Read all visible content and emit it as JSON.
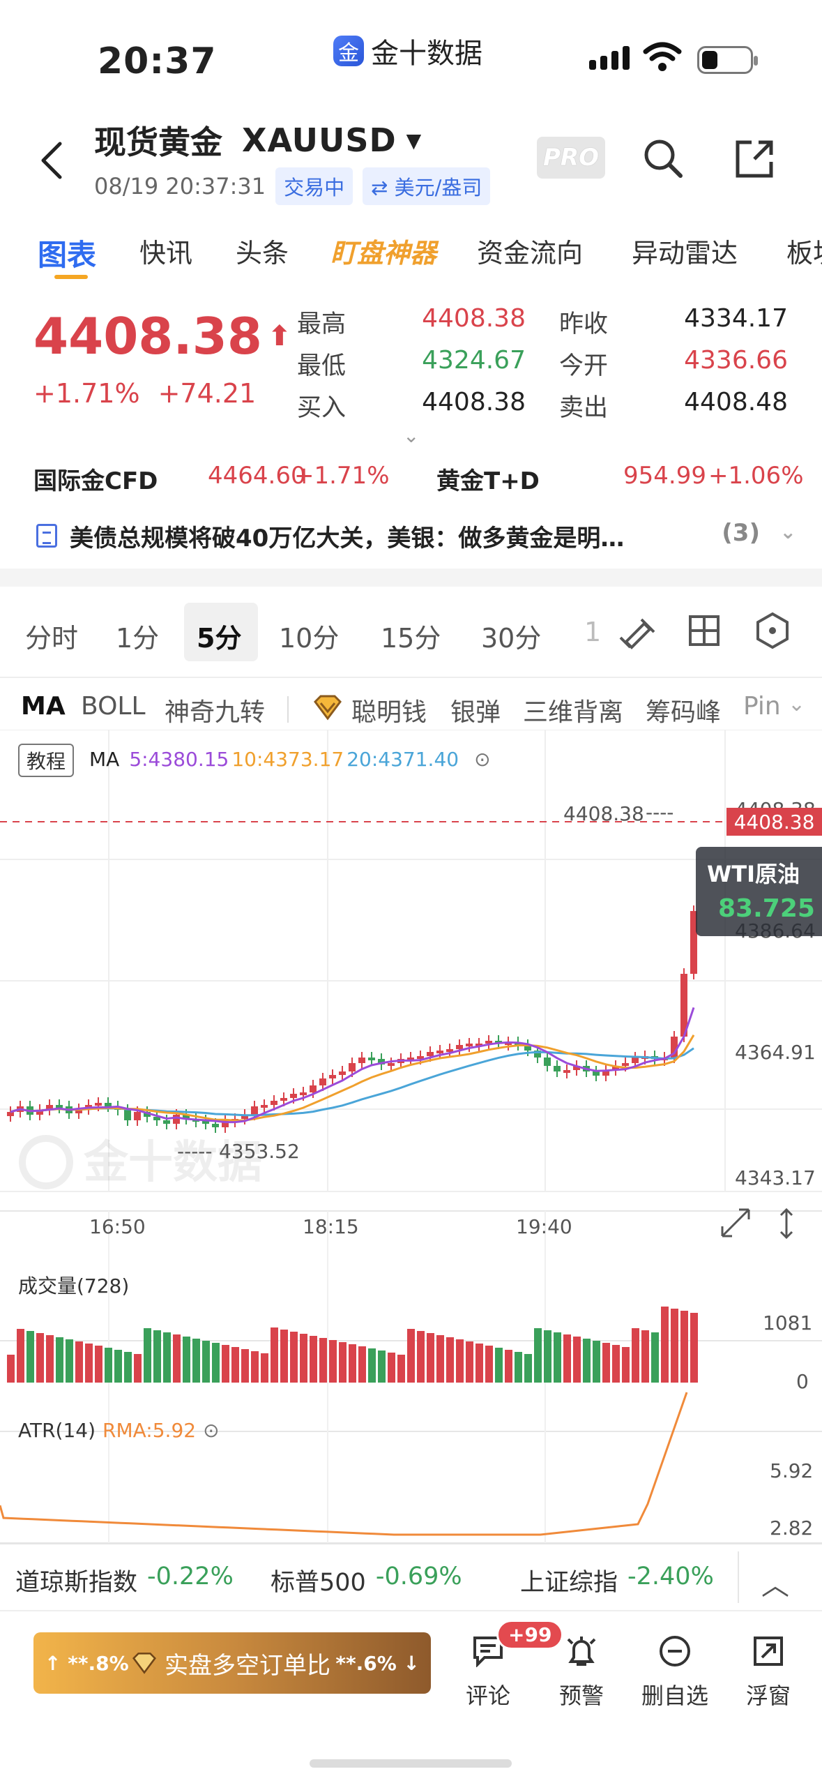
{
  "status_bar": {
    "time": "20:37",
    "app_name": "金十数据",
    "app_logo_glyph": "金"
  },
  "header": {
    "title": "现货黄金",
    "symbol": "XAUUSD",
    "datetime": "08/19 20:37:31",
    "trading_status": "交易中",
    "unit_tag": "⇄ 美元/盎司",
    "pro_label": "PRO"
  },
  "tabs": [
    "图表",
    "快讯",
    "头条",
    "盯盘神器",
    "资金流向",
    "异动雷达",
    "板块"
  ],
  "quote": {
    "price": "4408.38",
    "change_pct": "+1.71%",
    "change_abs": "+74.21",
    "high_label": "最高",
    "high": "4408.38",
    "low_label": "最低",
    "low": "4324.67",
    "bid_label": "买入",
    "bid": "4408.38",
    "prev_close_label": "昨收",
    "prev_close": "4334.17",
    "open_label": "今开",
    "open": "4336.66",
    "ask_label": "卖出",
    "ask": "4408.48"
  },
  "related": {
    "cfd_label": "国际金CFD",
    "cfd_price": "4464.60",
    "cfd_change": "+1.71%",
    "td_label": "黄金T+D",
    "td_price": "954.99",
    "td_change": "+1.06%"
  },
  "news": {
    "headline": "美债总规模将破40万亿大关，美银：做多黄金是明…",
    "count": "(3)"
  },
  "periods": [
    "分时",
    "1分",
    "5分",
    "10分",
    "15分",
    "30分",
    "1"
  ],
  "indicators": [
    "MA",
    "BOLL",
    "神奇九转",
    "聪明钱",
    "银弹",
    "三维背离",
    "筹码峰",
    "Pin"
  ],
  "chart": {
    "tutorial_label": "教程",
    "ma_label": "MA",
    "ma5": "5:4380.15",
    "ma10": "10:4373.17",
    "ma20": "20:4371.40",
    "y_top_label": "4408.38",
    "y_labels": [
      "4386.64",
      "4364.91",
      "4343.17"
    ],
    "high_marker": "4408.38",
    "low_marker": "4353.52",
    "last_price_tag": "4408.38",
    "x_labels": [
      "16:50",
      "18:15",
      "19:40"
    ],
    "volume_label": "成交量(728)",
    "volume_axis": [
      "1081",
      "0"
    ],
    "atr_label": "ATR(14)",
    "atr_rma": "RMA:5.92",
    "atr_axis": [
      "5.92",
      "2.82"
    ],
    "wti_title": "WTI原油",
    "wti_value": "83.725",
    "colors": {
      "up": "#d9434b",
      "down": "#3aa05a",
      "ma5": "#9b4bd9",
      "ma10": "#f0a02d",
      "ma20": "#4aa5d8"
    }
  },
  "index_bar": [
    {
      "name": "道琼斯指数",
      "change": "-0.22%"
    },
    {
      "name": "标普500",
      "change": "-0.69%"
    },
    {
      "name": "上证综指",
      "change": "-2.40%"
    }
  ],
  "bottom": {
    "ratio_left": "↑ **.8%",
    "ratio_label": "实盘多空订单比",
    "ratio_right": "**.6% ↓",
    "comment_badge": "+99",
    "actions": [
      "评论",
      "预警",
      "删自选",
      "浮窗"
    ]
  }
}
